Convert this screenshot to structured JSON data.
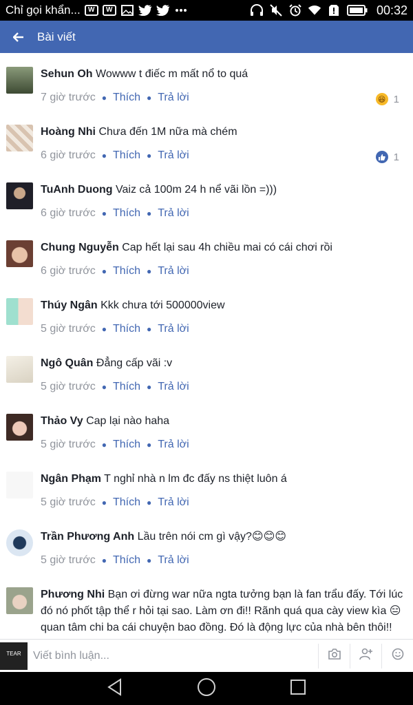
{
  "status": {
    "notification_text": "Chỉ gọi khẩn...",
    "time": "00:32",
    "left_icons": [
      "w-box-icon",
      "w-box-icon",
      "image-icon",
      "twitter-icon",
      "twitter-icon",
      "more-icon"
    ],
    "right_icons": [
      "headphones-icon",
      "mute-icon",
      "alarm-icon",
      "wifi-icon",
      "sim-alert-icon",
      "battery-icon"
    ]
  },
  "appbar": {
    "title": "Bài viết",
    "back_icon": "arrow-left-icon",
    "color": "#4267b2"
  },
  "comments": [
    {
      "name": "Sehun Oh",
      "text": "Wowww t điếc m mất nổ to quá",
      "time": "7 giờ trước",
      "like": "Thích",
      "reply": "Trả lời",
      "reaction": {
        "type": "haha",
        "count": "1"
      },
      "avatar_color": "#5a6a4a"
    },
    {
      "name": "Hoàng Nhi",
      "text": "Chưa đến 1M nữa mà chém",
      "time": "6 giờ trước",
      "like": "Thích",
      "reply": "Trả lời",
      "reaction": {
        "type": "like",
        "count": "1"
      },
      "avatar_color": "#c9b9a8"
    },
    {
      "name": "TuAnh Duong",
      "text": "Vaiz cả 100m 24 h nể vãi lồn =)))",
      "time": "6 giờ trước",
      "like": "Thích",
      "reply": "Trả lời",
      "avatar_color": "#2b2b33"
    },
    {
      "name": "Chung Nguyễn",
      "text": "Cap hết lại sau 4h chiều mai có cái chơi rồi",
      "time": "6 giờ trước",
      "like": "Thích",
      "reply": "Trả lời",
      "avatar_color": "#7a4e3e"
    },
    {
      "name": "Thúy Ngân",
      "text": "Kkk chưa tới 500000view",
      "time": "5 giờ trước",
      "like": "Thích",
      "reply": "Trả lời",
      "avatar_color": "#8fd3c2"
    },
    {
      "name": "Ngô Quân",
      "text": "Đẳng cấp vãi :v",
      "time": "5 giờ trước",
      "like": "Thích",
      "reply": "Trả lời",
      "avatar_color": "#e9e4d8"
    },
    {
      "name": "Thảo Vy",
      "text": "Cap lại nào haha",
      "time": "5 giờ trước",
      "like": "Thích",
      "reply": "Trả lời",
      "avatar_color": "#b07a6a"
    },
    {
      "name": "Ngân Phạm",
      "text": "T nghỉ nhà n lm đc đấy ns thiệt luôn á",
      "time": "5 giờ trước",
      "like": "Thích",
      "reply": "Trả lời",
      "avatar_color": "#f2f2f2"
    },
    {
      "name": "Trần Phương Anh",
      "text": "Lầu trên nói cm gì vậy?😊😊😊",
      "time": "5 giờ trước",
      "like": "Thích",
      "reply": "Trả lời",
      "avatar_color": "#d7e3f1"
    },
    {
      "name": "Phương Nhi",
      "text": "Bạn ơi đừng war nữa ngta tưởng bạn là fan trẩu đấy. Tới lúc đó nó phốt tập thể r hỏi tại sao. Làm ơn đi!! Rãnh quá qua cày view kìa 😑 quan tâm chi ba cái chuyện bao đồng. Đó là động lực của nhà bên thôi!!",
      "avatar_color": "#cfd6c4"
    }
  ],
  "input": {
    "placeholder": "Viết bình luận...",
    "avatar_text": "TEAR",
    "actions": [
      "camera-icon",
      "tag-person-icon",
      "emoji-icon"
    ]
  },
  "nav": {
    "buttons": [
      "back-triangle-icon",
      "home-circle-icon",
      "recents-square-icon"
    ]
  }
}
